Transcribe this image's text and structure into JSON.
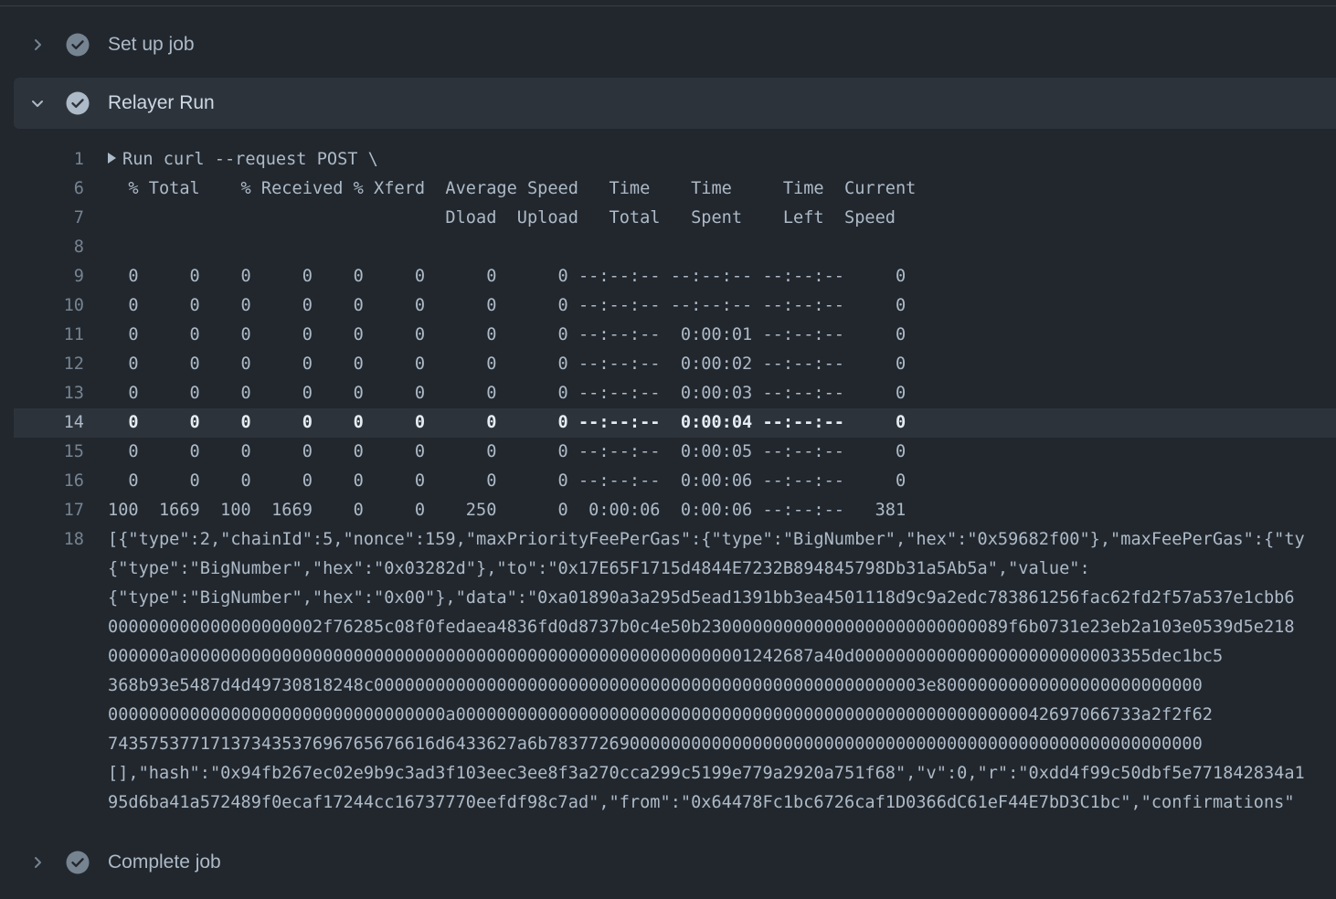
{
  "steps": {
    "setup": {
      "title": "Set up job",
      "state": "collapsed"
    },
    "relayer": {
      "title": "Relayer Run",
      "state": "expanded"
    },
    "complete": {
      "title": "Complete job",
      "state": "collapsed"
    }
  },
  "icons": {
    "chevron_collapsed": "chevron-right-icon",
    "chevron_expanded": "chevron-down-icon",
    "status": "check-circle-icon"
  },
  "colors": {
    "background": "#22272e",
    "active_header": "#2d333b",
    "check_fill": "#768390"
  },
  "log": {
    "lines": [
      {
        "n": "1",
        "text": "Run curl --request POST \\",
        "group": true
      },
      {
        "n": "6",
        "text": "  % Total    % Received % Xferd  Average Speed   Time    Time     Time  Current"
      },
      {
        "n": "7",
        "text": "                                 Dload  Upload   Total   Spent    Left  Speed"
      },
      {
        "n": "8",
        "text": ""
      },
      {
        "n": "9",
        "text": "  0     0    0     0    0     0      0      0 --:--:-- --:--:-- --:--:--     0"
      },
      {
        "n": "10",
        "text": "  0     0    0     0    0     0      0      0 --:--:-- --:--:-- --:--:--     0"
      },
      {
        "n": "11",
        "text": "  0     0    0     0    0     0      0      0 --:--:--  0:00:01 --:--:--     0"
      },
      {
        "n": "12",
        "text": "  0     0    0     0    0     0      0      0 --:--:--  0:00:02 --:--:--     0"
      },
      {
        "n": "13",
        "text": "  0     0    0     0    0     0      0      0 --:--:--  0:00:03 --:--:--     0"
      },
      {
        "n": "14",
        "text": "  0     0    0     0    0     0      0      0 --:--:--  0:00:04 --:--:--     0",
        "highlight": true
      },
      {
        "n": "15",
        "text": "  0     0    0     0    0     0      0      0 --:--:--  0:00:05 --:--:--     0"
      },
      {
        "n": "16",
        "text": "  0     0    0     0    0     0      0      0 --:--:--  0:00:06 --:--:--     0"
      },
      {
        "n": "17",
        "text": "100  1669  100  1669    0     0    250      0  0:00:06  0:00:06 --:--:--   381"
      }
    ],
    "line18": {
      "n": "18",
      "wrapped": [
        "[{\"type\":2,\"chainId\":5,\"nonce\":159,\"maxPriorityFeePerGas\":{\"type\":\"BigNumber\",\"hex\":\"0x59682f00\"},\"maxFeePerGas\":{\"ty",
        "{\"type\":\"BigNumber\",\"hex\":\"0x03282d\"},\"to\":\"0x17E65F1715d4844E7232B894845798Db31a5Ab5a\",\"value\":",
        "{\"type\":\"BigNumber\",\"hex\":\"0x00\"},\"data\":\"0xa01890a3a295d5ead1391bb3ea4501118d9c9a2edc783861256fac62fd2f57a537e1cbb6",
        "000000000000000000002f76285c08f0fedaea4836fd0d8737b0c4e50b230000000000000000000000000089f6b0731e23eb2a103e0539d5e218",
        "000000a00000000000000000000000000000000000000000000000000000001242687a40d00000000000000000000000003355dec1bc5",
        "368b93e5487d4d49730818248c000000000000000000000000000000000000000000000000000003e80000000000000000000000000",
        "000000000000000000000000000000000a0000000000000000000000000000000000000000000000000000000042697066733a2f2f62",
        "74357537717137343537696765676616d6433627a6b7837726900000000000000000000000000000000000000000000000000000000",
        "[],\"hash\":\"0x94fb267ec02e9b9c3ad3f103eec3ee8f3a270cca299c5199e779a2920a751f68\",\"v\":0,\"r\":\"0xdd4f99c50dbf5e771842834a1",
        "95d6ba41a572489f0ecaf17244cc16737770eefdf98c7ad\",\"from\":\"0x64478Fc1bc6726caf1D0366dC61eF44E7bD3C1bc\",\"confirmations\""
      ]
    }
  }
}
